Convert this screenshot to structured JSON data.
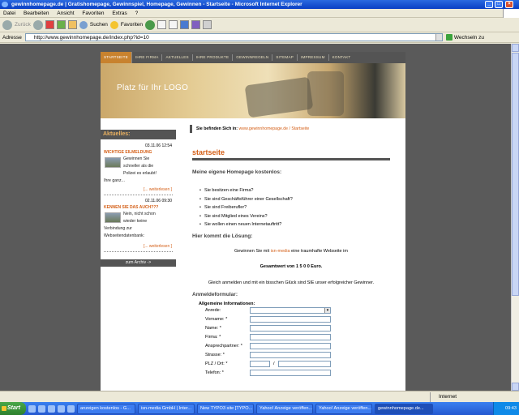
{
  "window": {
    "title": "gewinnhomepage.de | Gratishomepage, Gewinnspiel, Homepage, Gewinnen - Startseite - Microsoft Internet Explorer",
    "min": "_",
    "max": "□",
    "close": "×"
  },
  "menubar": [
    "Datei",
    "Bearbeiten",
    "Ansicht",
    "Favoriten",
    "Extras",
    "?"
  ],
  "toolbar": {
    "back": "Zurück",
    "search": "Suchen",
    "favorites": "Favoriten"
  },
  "address": {
    "label": "Adresse",
    "url": "http://www.gewinnhomepage.de/index.php?id=10",
    "go": "Wechseln zu"
  },
  "site": {
    "nav": [
      "STARTSEITE",
      "IHRE FIRMA",
      "AKTUELLES",
      "IHRE PRODUKTE",
      "GEWINNREGELN",
      "SITEMAP",
      "IMPRESSUM",
      "KONTAKT"
    ],
    "logo": "Platz für Ihr LOGO",
    "news": {
      "heading": "Aktuelles:",
      "items": [
        {
          "date": "03.11.06 12:54",
          "title": "WICHTIGE EILMELDUNG",
          "text_a": "Gewinnen Sie",
          "text_b": "schneller als die",
          "text_c": "Polizei es erlaubt!",
          "text_d": "Ihre ganz...",
          "more": "[... weiterlesen ]"
        },
        {
          "date": "02.11.06 09:30",
          "title": "KENNEN SIE DAS AUCH???",
          "text_a": "Nein, nicht schon",
          "text_b": "wieder keine",
          "text_c": "Verbindung zur",
          "text_d": "Webseitendatenbank:",
          "more": "[... weiterlesen ]"
        }
      ],
      "archive": "zum Archiv ->"
    },
    "breadcrumb": {
      "label": "Sie befinden Sich in:",
      "path": "www.gewinnhomepage.de / Startseite"
    },
    "page_title": "startseite",
    "intro_heading": "Meine eigene Homepage kostenlos:",
    "bullets": [
      "Sie besitzen eine Firma?",
      "Sie sind Geschäftsführer einer Gesellschaft?",
      "Sie sind Freiberufler?",
      "Sie sind Mitglied eines Vereins?",
      "Sie wollen einen neuen Internetauftritt?"
    ],
    "solution_heading": "Hier kommt die Lösung:",
    "win_pre": "Gewinnen Sie mit",
    "win_brand": "isn-media",
    "win_post": "eine traumhafte Webseite im",
    "total": "Gesamtwert von 1 5 0 0 Euro.",
    "luck": "Gleich anmelden und mit ein bisschen Glück sind SIE unser erfolgreicher Gewinner.",
    "form_heading": "Anmeldeformular:",
    "form_section": "Allgemeine Informationen:",
    "fields": [
      "Anrede:",
      "Vorname: *",
      "Name: *",
      "Firma: *",
      "Ansprechpartner: *",
      "Strasse: *",
      "PLZ / Ort: *",
      "Telefon: *"
    ],
    "plz_sep": "/"
  },
  "statusbar": {
    "zone": "Internet"
  },
  "taskbar": {
    "start": "Start",
    "tasks": [
      "anzeigen kostenlos - G...",
      "isn-media GmbH | Inter...",
      "New TYPO3 site [TYPO...",
      "Yahoo! Anzeige veröffen...",
      "Yahoo! Anzeige veröffen...",
      "gewinnhomepage.de..."
    ],
    "clock": "09:43"
  },
  "colors": {
    "accent": "#d45f17",
    "nav_bg": "#545454",
    "titlebar": "#0a3fc4"
  }
}
